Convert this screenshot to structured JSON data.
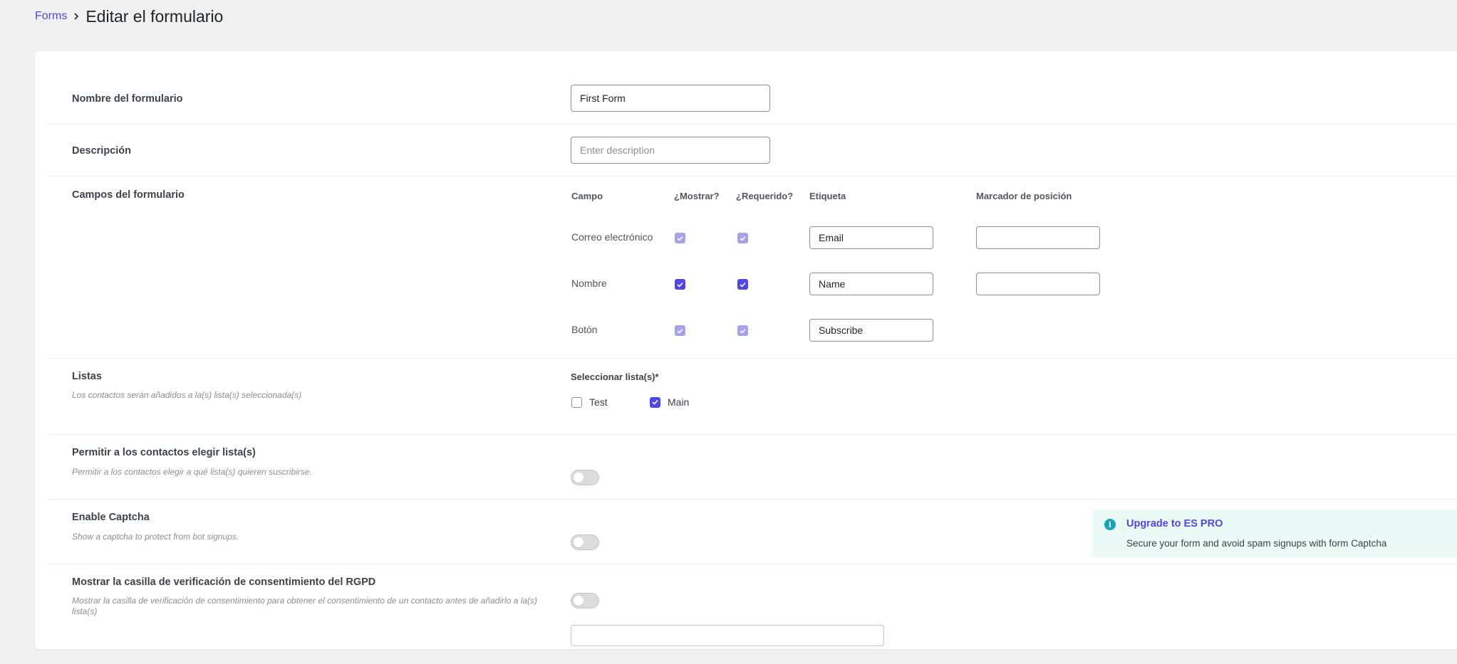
{
  "breadcrumb": {
    "root": "Forms",
    "current": "Editar el formulario"
  },
  "form_name": {
    "label": "Nombre del formulario",
    "value": "First Form"
  },
  "description": {
    "label": "Descripción",
    "placeholder": "Enter description"
  },
  "fields": {
    "label": "Campos del formulario",
    "headers": {
      "field": "Campo",
      "show": "¿Mostrar?",
      "required": "¿Requerido?",
      "label": "Etiqueta",
      "placeholder": "Marcador de posición"
    },
    "rows": [
      {
        "name": "Correo electrónico",
        "label_value": "Email",
        "show": true,
        "required": true,
        "locked": true
      },
      {
        "name": "Nombre",
        "label_value": "Name",
        "show": true,
        "required": true,
        "locked": false
      },
      {
        "name": "Botón",
        "label_value": "Subscribe",
        "show": true,
        "required": true,
        "locked": true
      }
    ]
  },
  "lists": {
    "label": "Listas",
    "help": "Los contactos serán añadidos a la(s) lista(s) seleccionada(s)",
    "select_label": "Seleccionar lista(s)*",
    "options": [
      {
        "name": "Test",
        "checked": false
      },
      {
        "name": "Main",
        "checked": true
      }
    ]
  },
  "allow_choose": {
    "label": "Permitir a los contactos elegir lista(s)",
    "help": "Permitir a los contactos elegir a qué lista(s) quieren suscribirse.",
    "enabled": false
  },
  "captcha": {
    "label": "Enable Captcha",
    "help": "Show a captcha to protect from bot signups.",
    "enabled": false
  },
  "upgrade_notice": {
    "title": "Upgrade to ES PRO",
    "text": "Secure your form and avoid spam signups with form Captcha",
    "icon": "info-icon"
  },
  "gdpr": {
    "label": "Mostrar la casilla de verificación de consentimiento del RGPD",
    "help": "Mostrar la casilla de verificación de consentimiento para obtener el consentimiento de un contacto antes de añadirlo a la(s) lista(s)",
    "enabled": false
  },
  "colors": {
    "accent": "#5046e5",
    "accent_dim": "#a5a1ef",
    "notice_bg": "#ecfaf7",
    "info": "#16a2b8"
  }
}
